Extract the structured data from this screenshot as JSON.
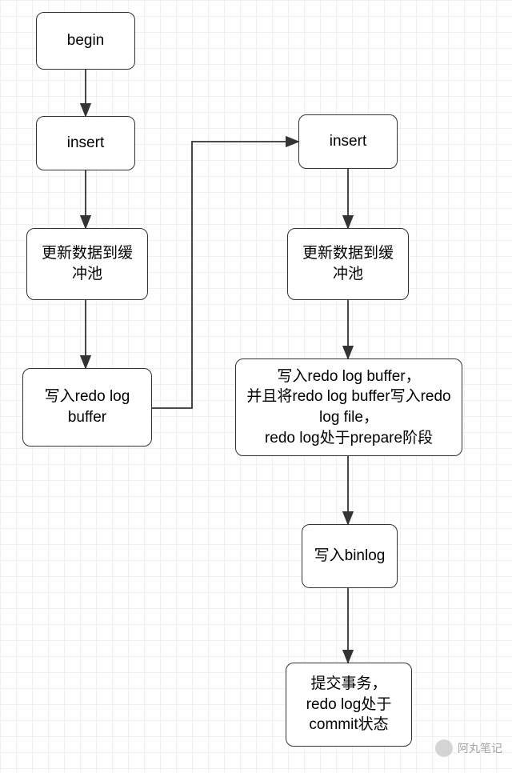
{
  "nodes": {
    "begin": "begin",
    "insert_left": "insert",
    "update_left": "更新数据到缓\n冲池",
    "redo_left": "写入redo log\nbuffer",
    "insert_right": "insert",
    "update_right": "更新数据到缓\n冲池",
    "redo_right": "写入redo log buffer，\n并且将redo log buffer写入redo\nlog file，\nredo log处于prepare阶段",
    "binlog": "写入binlog",
    "commit": "提交事务，\nredo log处于\ncommit状态"
  },
  "watermark": "阿丸笔记"
}
